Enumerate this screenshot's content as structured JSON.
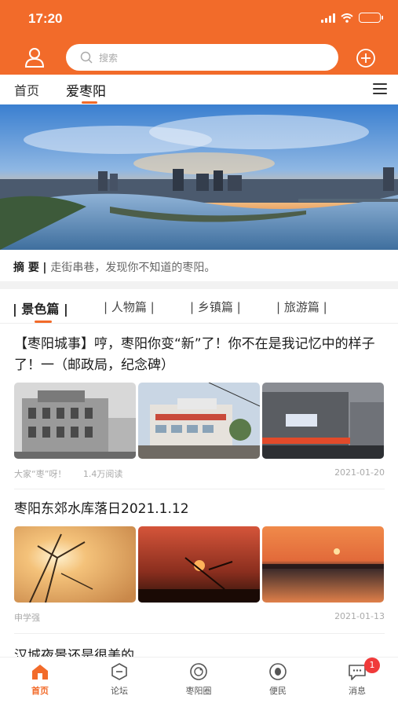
{
  "status_bar": {
    "time": "17:20"
  },
  "search": {
    "placeholder": "搜索"
  },
  "tabs": [
    {
      "label": "首页"
    },
    {
      "label": "爱枣阳",
      "active": true
    }
  ],
  "abstract": {
    "label": "摘 要",
    "text": "走街串巷，发现你不知道的枣阳。"
  },
  "categories": [
    {
      "label": "景色篇",
      "active": true
    },
    {
      "label": "人物篇"
    },
    {
      "label": "乡镇篇"
    },
    {
      "label": "旅游篇"
    }
  ],
  "articles": [
    {
      "title": "【枣阳城事】哼，枣阳你变“新”了！你不在是我记忆中的样子了！一（邮政局，纪念碑）",
      "author": "大家“枣”呀！",
      "reads": "1.4万阅读",
      "date": "2021-01-20"
    },
    {
      "title": "枣阳东郊水库落日2021.1.12",
      "author": "申学强",
      "date": "2021-01-13"
    }
  ],
  "partial_article_title": "汉城夜景还是很美的",
  "bottom_nav": [
    {
      "label": "首页",
      "icon": "home-icon",
      "active": true
    },
    {
      "label": "论坛",
      "icon": "forum-icon"
    },
    {
      "label": "枣阳圈",
      "icon": "circle-icon"
    },
    {
      "label": "便民",
      "icon": "service-icon"
    },
    {
      "label": "消息",
      "icon": "message-icon",
      "badge": "1"
    }
  ],
  "colors": {
    "accent": "#f26b2a",
    "badge": "#f03a3a"
  }
}
